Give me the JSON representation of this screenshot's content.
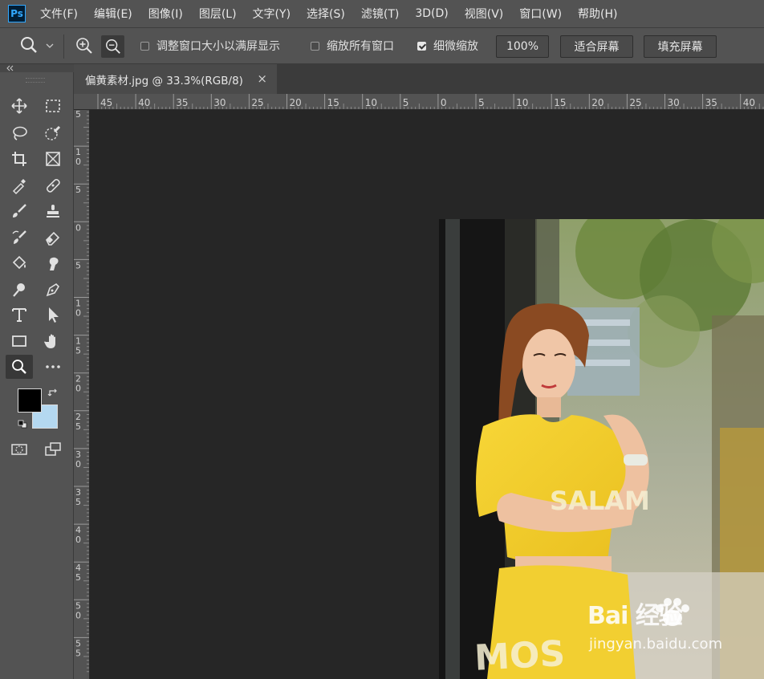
{
  "app": {
    "logo": "Ps"
  },
  "menu": [
    "文件(F)",
    "编辑(E)",
    "图像(I)",
    "图层(L)",
    "文字(Y)",
    "选择(S)",
    "滤镜(T)",
    "3D(D)",
    "视图(V)",
    "窗口(W)",
    "帮助(H)"
  ],
  "options": {
    "resize_windows_label": "调整窗口大小以满屏显示",
    "resize_windows_checked": false,
    "zoom_all_label": "缩放所有窗口",
    "zoom_all_checked": false,
    "scrubby_zoom_label": "细微缩放",
    "scrubby_zoom_checked": true,
    "zoom_value": "100%",
    "fit_screen_label": "适合屏幕",
    "fill_screen_label": "填充屏幕"
  },
  "document": {
    "tab_title": "偏黄素材.jpg @ 33.3%(RGB/8)",
    "close_glyph": "×"
  },
  "ruler_h": [
    "45",
    "40",
    "35",
    "30",
    "25",
    "20",
    "15",
    "10",
    "5",
    "0",
    "5",
    "10",
    "15",
    "20",
    "25",
    "30",
    "35",
    "40"
  ],
  "ruler_v": [
    "5",
    "1\n0",
    "5",
    "0",
    "5",
    "1\n0",
    "1\n5",
    "2\n0",
    "2\n5",
    "3\n0",
    "3\n5",
    "4\n0",
    "4\n5",
    "5\n0",
    "5\n5"
  ],
  "colors": {
    "foreground": "#000000",
    "background": "#b4d8f0"
  },
  "photo": {
    "shirt_text": "SALAM",
    "skirt_text": "MOS"
  },
  "watermark": {
    "brand": "Bai 经验",
    "url": "jingyan.baidu.com"
  }
}
